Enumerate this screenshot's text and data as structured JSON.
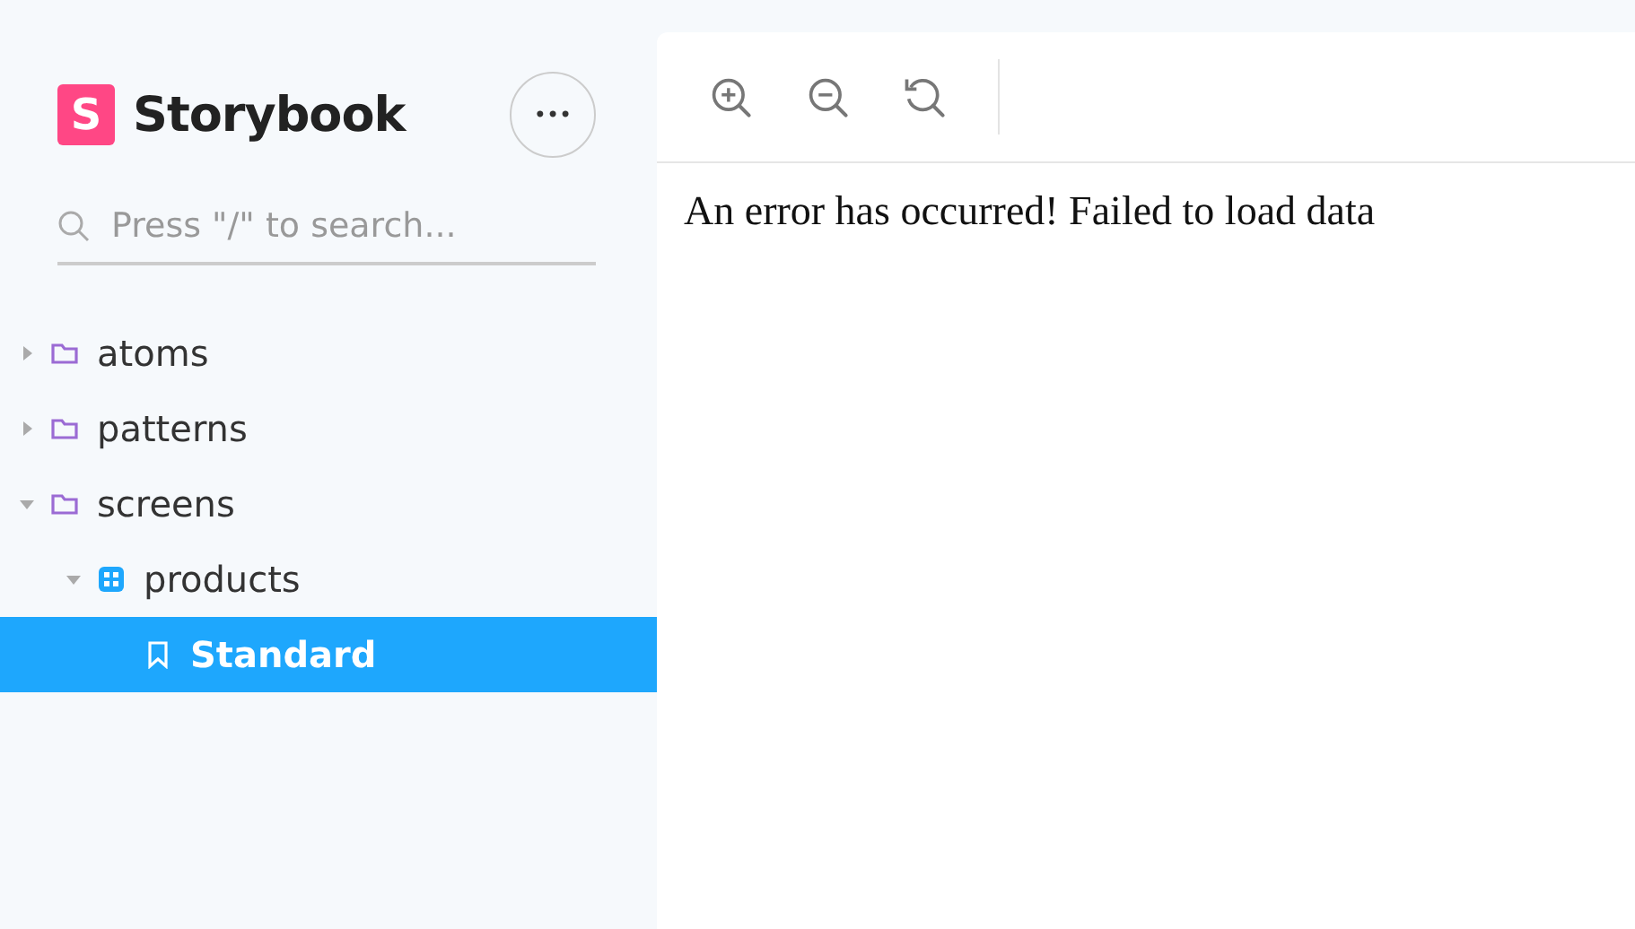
{
  "sidebar": {
    "brand": {
      "logo_letter": "S",
      "name": "Storybook"
    },
    "menu_button": "•••",
    "search": {
      "placeholder": "Press \"/\" to search..."
    },
    "tree": [
      {
        "kind": "folder",
        "label": "atoms",
        "expanded": false,
        "selected": false
      },
      {
        "kind": "folder",
        "label": "patterns",
        "expanded": false,
        "selected": false
      },
      {
        "kind": "folder",
        "label": "screens",
        "expanded": true,
        "selected": false,
        "children": [
          {
            "kind": "component",
            "label": "products",
            "expanded": true,
            "selected": false,
            "children": [
              {
                "kind": "story",
                "label": "Standard",
                "selected": true
              }
            ]
          }
        ]
      }
    ]
  },
  "preview": {
    "toolbar": [
      {
        "kind": "zoom_in"
      },
      {
        "kind": "zoom_out"
      },
      {
        "kind": "reset_zoom"
      }
    ],
    "message": "An error has occurred! Failed to load data"
  }
}
